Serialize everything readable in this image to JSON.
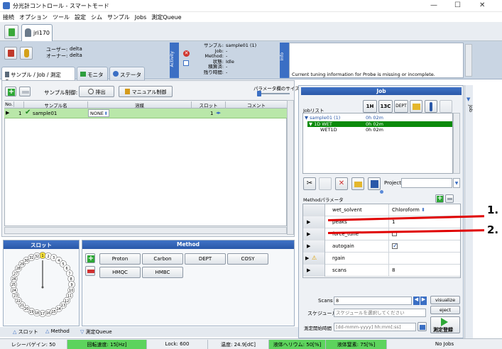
{
  "window": {
    "title": "分光計コントロール - スマートモード",
    "minimize": "—",
    "maximize": "☐",
    "close": "✕"
  },
  "menu": [
    "接続",
    "オプション",
    "ツール",
    "設定",
    "シム",
    "サンプル",
    "Jobs",
    "測定Queue"
  ],
  "top_tab": {
    "label": "jri170"
  },
  "user": {
    "user_label": "ユーザー:",
    "user_value": "delta",
    "owner_label": "オーナー:",
    "owner_value": "delta"
  },
  "activity": {
    "strip": "Activity",
    "sample_label": "サンプル:",
    "sample_value": "sample01 (1)",
    "job_label": "Job:",
    "job_value": "-",
    "method_label": "Method:",
    "method_value": "-",
    "state_label": "状態:",
    "state_value": "Idle",
    "elapsed_label": "積算済:",
    "elapsed_value": "-",
    "remain_label": "残り時間:",
    "remain_value": "-"
  },
  "info": {
    "strip": "Info",
    "message": "Current tuning information for Probe is missing or incomplete."
  },
  "pane_tabs": [
    "サンプル / Job / 測定Queue",
    "モニタ",
    "ステータス"
  ],
  "sample_ctrl": {
    "label": "サンプル制御:",
    "eject": "排出",
    "manual": "マニュアル制御",
    "param_width_label": "パラメータ欄のサイズ"
  },
  "table": {
    "headers": [
      "No.",
      "",
      "サンプル名",
      "溶媒",
      "スロット",
      "コメント"
    ],
    "row": {
      "no": "1",
      "name": "sample01",
      "solvent": "NONE",
      "slot": "1"
    }
  },
  "slot_panel": {
    "title": "スロット",
    "numbers": [
      "1",
      "2",
      "3",
      "4",
      "5",
      "6",
      "7",
      "8",
      "9",
      "10",
      "11",
      "12",
      "13",
      "14",
      "15",
      "16",
      "17",
      "18",
      "19",
      "20",
      "21",
      "22",
      "23",
      "24",
      "25",
      "26",
      "27",
      "28",
      "29",
      "30",
      "31",
      "32"
    ]
  },
  "method_panel": {
    "title": "Method",
    "buttons": [
      "Proton",
      "Carbon",
      "DEPT",
      "COSY",
      "HMQC",
      "HMBC"
    ]
  },
  "bottom_tabs": [
    "スロット",
    "Method",
    "測定Queue"
  ],
  "job": {
    "title": "Job",
    "side": "Job",
    "joblist_label": "Jobリスト",
    "tool_1h": "1H",
    "tool_13c": "13C",
    "tool_dept": "DEPT",
    "items": [
      {
        "name": "sample01 (1)",
        "time": "0h 02m"
      },
      {
        "name": "1D WET",
        "time": "0h 02m"
      },
      {
        "name": "WET1D",
        "time": "0h 02m"
      }
    ],
    "project_label": "Project",
    "method_param_label": "Methodパラメータ"
  },
  "params": [
    {
      "name": "wet_solvent",
      "value": "Chloroform"
    },
    {
      "name": "peaks",
      "value": "1"
    },
    {
      "name": "force_tune",
      "value": ""
    },
    {
      "name": "autogain",
      "value": ""
    },
    {
      "name": "rgain",
      "value": ""
    },
    {
      "name": "scans",
      "value": "8"
    }
  ],
  "scans": {
    "label": "Scans",
    "value": "8",
    "visualize": "visualize",
    "eject": "eject"
  },
  "schedule": {
    "label": "スケジュール",
    "placeholder": "スケジュールを選択してください"
  },
  "start_time": {
    "label": "測定開始時間",
    "placeholder": "[dd-mmm-yyyy] hh:mm[:ss]"
  },
  "register": {
    "label": "測定登録"
  },
  "status": [
    "レシーバゲイン: 50",
    "回転速度: 15[Hz]",
    "Lock: 600",
    "温度: 24.9[dC]",
    "液体ヘリウム: 50[%]",
    "液体窒素: 75[%]",
    "No Jobs"
  ],
  "annotations": [
    "1.",
    "2."
  ],
  "colors": {
    "accent": "#3b6fc4",
    "row_green": "#b9e7a9",
    "job_selected": "#0a8a0a",
    "status_green": "#5dd35d",
    "annotation_red": "#e00000"
  }
}
